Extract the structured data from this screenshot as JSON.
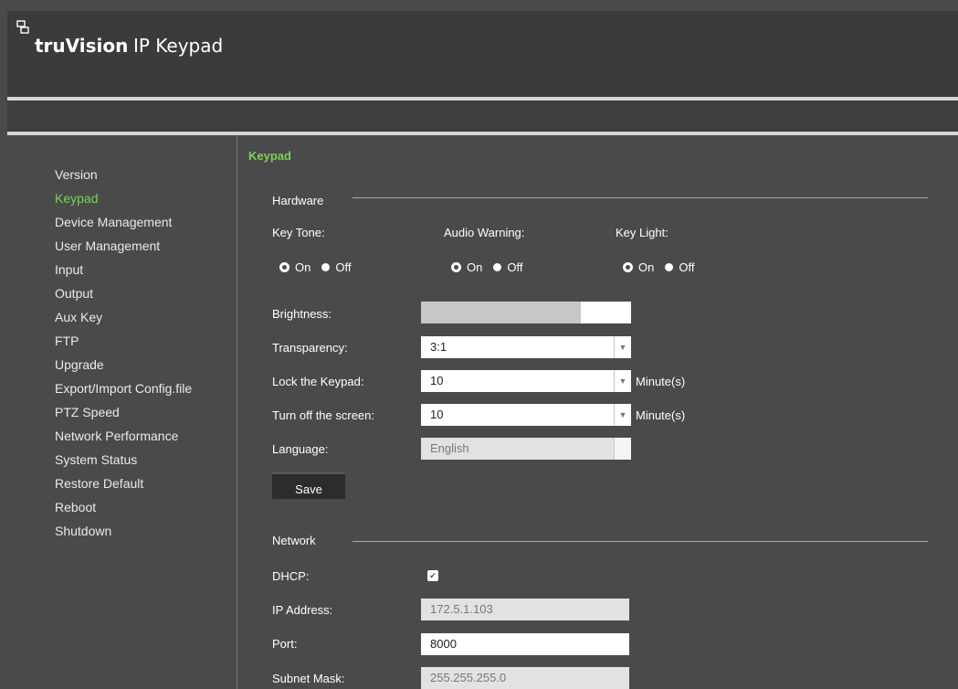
{
  "app": {
    "brand_bold": "truVision",
    "brand_rest": "IP Keypad"
  },
  "sidebar": {
    "items": [
      {
        "label": "Version"
      },
      {
        "label": "Keypad",
        "active": true
      },
      {
        "label": "Device Management"
      },
      {
        "label": "User Management"
      },
      {
        "label": "Input"
      },
      {
        "label": "Output"
      },
      {
        "label": "Aux Key"
      },
      {
        "label": "FTP"
      },
      {
        "label": "Upgrade"
      },
      {
        "label": "Export/Import Config.file"
      },
      {
        "label": "PTZ Speed"
      },
      {
        "label": "Network Performance"
      },
      {
        "label": "System Status"
      },
      {
        "label": "Restore Default"
      },
      {
        "label": "Reboot"
      },
      {
        "label": "Shutdown"
      }
    ]
  },
  "page": {
    "title": "Keypad",
    "hardware": {
      "section_label": "Hardware",
      "key_tone": {
        "label": "Key Tone:",
        "on": "On",
        "off": "Off",
        "selected": "On"
      },
      "audio_warning": {
        "label": "Audio Warning:",
        "on": "On",
        "off": "Off",
        "selected": "On"
      },
      "key_light": {
        "label": "Key Light:",
        "on": "On",
        "off": "Off",
        "selected": "On"
      },
      "brightness": {
        "label": "Brightness:",
        "level_percent": 76
      },
      "transparency": {
        "label": "Transparency:",
        "value": "3:1"
      },
      "lock_keypad": {
        "label": "Lock the Keypad:",
        "value": "10",
        "unit": "Minute(s)"
      },
      "screen_off": {
        "label": "Turn off the screen:",
        "value": "10",
        "unit": "Minute(s)"
      },
      "language": {
        "label": "Language:",
        "value": "English"
      },
      "save_label": "Save"
    },
    "network": {
      "section_label": "Network",
      "dhcp": {
        "label": "DHCP:",
        "checked": true
      },
      "ip": {
        "label": "IP Address:",
        "value": "172.5.1.103"
      },
      "port": {
        "label": "Port:",
        "value": "8000"
      },
      "subnet": {
        "label": "Subnet Mask:",
        "value": "255.255.255.0"
      }
    }
  },
  "colors": {
    "accent_green": "#7dd157",
    "background": "#4a4a4a",
    "header": "#3b3b3b"
  }
}
